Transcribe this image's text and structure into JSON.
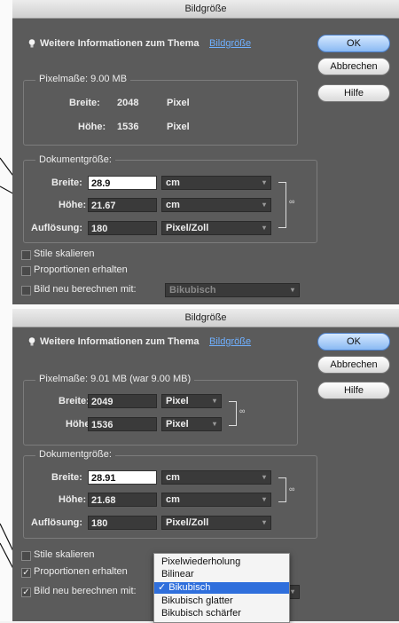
{
  "dialog1": {
    "title": "Bildgröße",
    "info_prefix": "Weitere Informationen zum Thema",
    "info_link": "Bildgröße",
    "ok": "OK",
    "cancel": "Abbrechen",
    "help": "Hilfe",
    "pixel_dims": {
      "legend": "Pixelmaße: 9.00 MB",
      "width_label": "Breite:",
      "width_value": "2048",
      "width_unit": "Pixel",
      "height_label": "Höhe:",
      "height_value": "1536",
      "height_unit": "Pixel"
    },
    "doc_size": {
      "legend": "Dokumentgröße:",
      "width_label": "Breite:",
      "width_value": "28.9",
      "width_unit": "cm",
      "height_label": "Höhe:",
      "height_value": "21.67",
      "height_unit": "cm",
      "res_label": "Auflösung:",
      "res_value": "180",
      "res_unit": "Pixel/Zoll"
    },
    "checks": {
      "scale_styles": "Stile skalieren",
      "constrain": "Proportionen erhalten",
      "resample": "Bild neu berechnen mit:",
      "resample_value": "Bikubisch"
    }
  },
  "dialog2": {
    "title": "Bildgröße",
    "info_prefix": "Weitere Informationen zum Thema",
    "info_link": "Bildgröße",
    "ok": "OK",
    "cancel": "Abbrechen",
    "help": "Hilfe",
    "pixel_dims": {
      "legend": "Pixelmaße: 9.01 MB (war 9.00 MB)",
      "width_label": "Breite:",
      "width_value": "2049",
      "width_unit": "Pixel",
      "height_label": "Höhe:",
      "height_value": "1536",
      "height_unit": "Pixel"
    },
    "doc_size": {
      "legend": "Dokumentgröße:",
      "width_label": "Breite:",
      "width_value": "28.91",
      "width_unit": "cm",
      "height_label": "Höhe:",
      "height_value": "21.68",
      "height_unit": "cm",
      "res_label": "Auflösung:",
      "res_value": "180",
      "res_unit": "Pixel/Zoll"
    },
    "checks": {
      "scale_styles": "Stile skalieren",
      "constrain": "Proportionen erhalten",
      "resample": "Bild neu berechnen mit:",
      "check_mark": "✓"
    },
    "menu": {
      "check": "✓",
      "items": [
        "Pixelwiederholung",
        "Bilinear",
        "Bikubisch",
        "Bikubisch glatter",
        "Bikubisch schärfer"
      ]
    }
  },
  "colors": {
    "panel": "#5b5b5b",
    "accent": "#2f6fdc",
    "link": "#6fb0ff"
  }
}
